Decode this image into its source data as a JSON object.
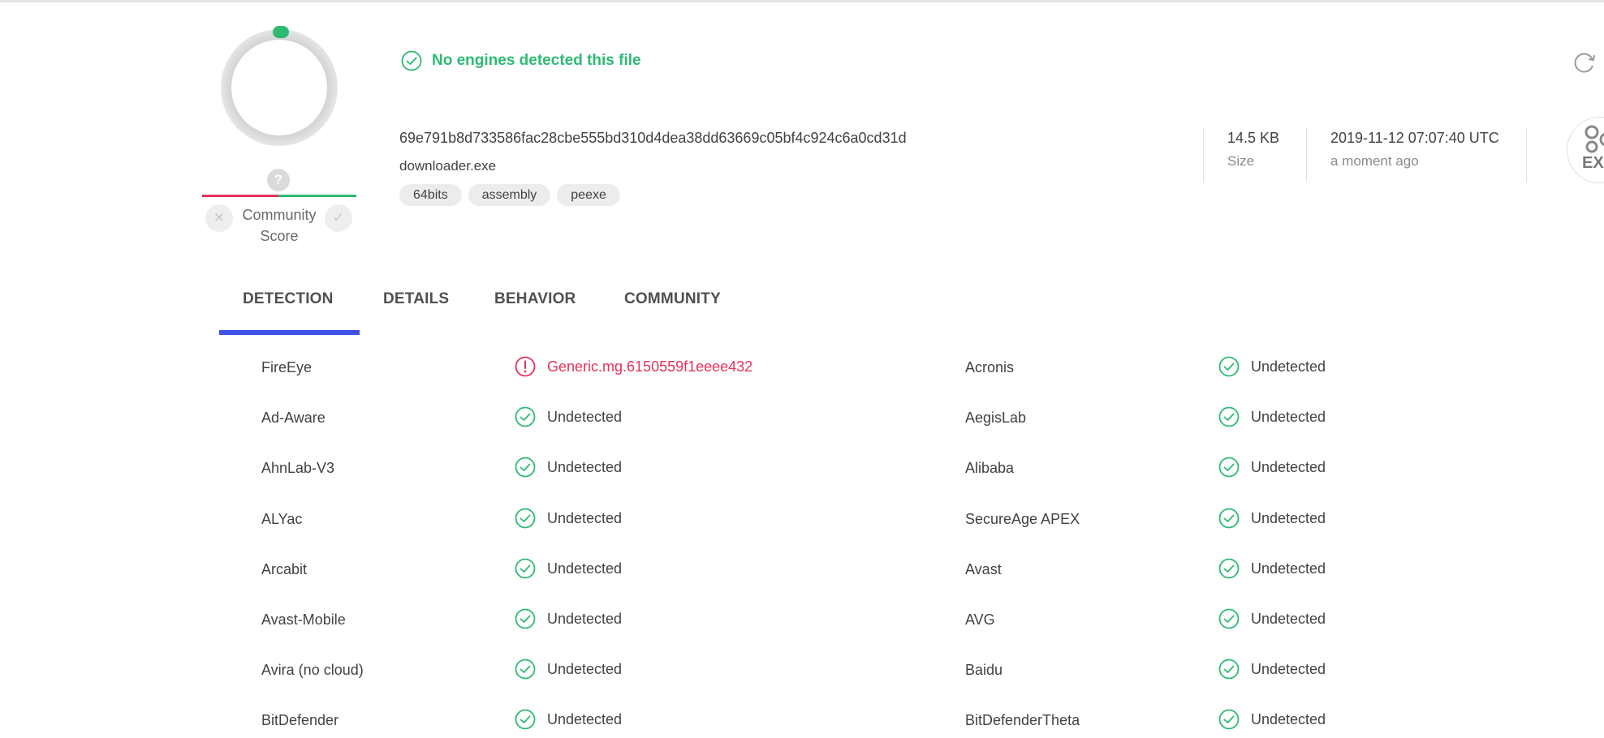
{
  "header": {
    "status_text": "No engines detected this file",
    "hash": "69e791b8d733586fac28cbe555bd310d4dea38dd63669c05bf4c924c6a0cd31d",
    "filename": "downloader.exe",
    "tags": [
      "64bits",
      "assembly",
      "peexe"
    ],
    "size_value": "14.5 KB",
    "size_label": "Size",
    "date_value": "2019-11-12 07:07:40 UTC",
    "date_label": "a moment ago",
    "filetype_label": "EX"
  },
  "community": {
    "question": "?",
    "label_line1": "Community",
    "label_line2": "Score"
  },
  "tabs": [
    "DETECTION",
    "DETAILS",
    "BEHAVIOR",
    "COMMUNITY"
  ],
  "results": {
    "left": [
      {
        "engine": "FireEye",
        "result": "Generic.mg.6150559f1eeee432",
        "status": "malicious"
      },
      {
        "engine": "Ad-Aware",
        "result": "Undetected",
        "status": "clean"
      },
      {
        "engine": "AhnLab-V3",
        "result": "Undetected",
        "status": "clean"
      },
      {
        "engine": "ALYac",
        "result": "Undetected",
        "status": "clean"
      },
      {
        "engine": "Arcabit",
        "result": "Undetected",
        "status": "clean"
      },
      {
        "engine": "Avast-Mobile",
        "result": "Undetected",
        "status": "clean"
      },
      {
        "engine": "Avira (no cloud)",
        "result": "Undetected",
        "status": "clean"
      },
      {
        "engine": "BitDefender",
        "result": "Undetected",
        "status": "clean"
      }
    ],
    "right": [
      {
        "engine": "Acronis",
        "result": "Undetected",
        "status": "clean"
      },
      {
        "engine": "AegisLab",
        "result": "Undetected",
        "status": "clean"
      },
      {
        "engine": "Alibaba",
        "result": "Undetected",
        "status": "clean"
      },
      {
        "engine": "SecureAge APEX",
        "result": "Undetected",
        "status": "clean"
      },
      {
        "engine": "Avast",
        "result": "Undetected",
        "status": "clean"
      },
      {
        "engine": "AVG",
        "result": "Undetected",
        "status": "clean"
      },
      {
        "engine": "Baidu",
        "result": "Undetected",
        "status": "clean"
      },
      {
        "engine": "BitDefenderTheta",
        "result": "Undetected",
        "status": "clean"
      }
    ]
  },
  "colors": {
    "clean": "#2dbb72",
    "malicious": "#e7315c",
    "tab_accent": "#3f51e6"
  },
  "icons": {
    "status": "check-circle-icon",
    "refresh": "refresh-icon",
    "clean": "check-circle-icon",
    "malicious": "alert-circle-icon"
  }
}
